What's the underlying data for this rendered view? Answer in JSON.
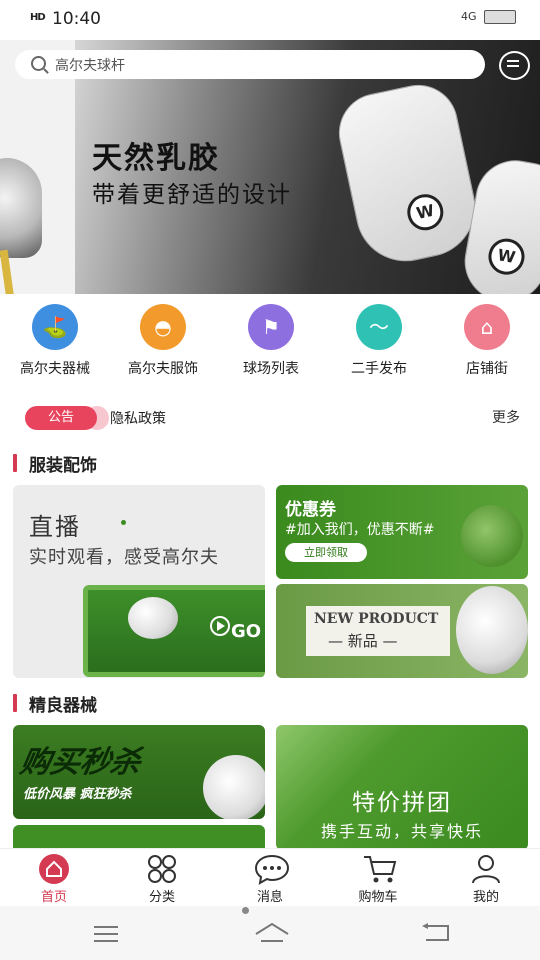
{
  "status_bar": {
    "time": "10:40",
    "signal": "HD",
    "network": "4G"
  },
  "search": {
    "placeholder": "高尔夫球杆"
  },
  "banner": {
    "title": "天然乳胶",
    "subtitle": "带着更舒适的设计",
    "glove_mark": "W"
  },
  "categories": [
    {
      "label": "高尔夫器械",
      "color": "#3f8fe0",
      "icon": "golf-club-icon"
    },
    {
      "label": "高尔夫服饰",
      "color": "#f39a2c",
      "icon": "cap-icon"
    },
    {
      "label": "球场列表",
      "color": "#8e6fe0",
      "icon": "golf-course-icon"
    },
    {
      "label": "二手发布",
      "color": "#2fc2b4",
      "icon": "exchange-icon"
    },
    {
      "label": "店铺街",
      "color": "#f07d8e",
      "icon": "shop-icon"
    }
  ],
  "notice": {
    "tag": "公告",
    "text": "隐私政策",
    "more": "更多"
  },
  "sections": {
    "apparel": "服装配饰",
    "equipment": "精良器械"
  },
  "live_card": {
    "title": "直播",
    "subtitle": "实时观看，感受高尔夫",
    "go": "GO"
  },
  "coupon_card": {
    "title": "优惠券",
    "subtitle": "#加入我们，优惠不断#",
    "button": "立即领取"
  },
  "new_product_card": {
    "title": "NEW PRODUCT",
    "subtitle": "— 新品 —"
  },
  "flash_sale_card": {
    "title": "购买秒杀",
    "subtitle": "低价风暴  疯狂秒杀"
  },
  "group_buy_card": {
    "title": "特价拼团",
    "subtitle": "携手互动，共享快乐"
  },
  "tabbar": [
    {
      "label": "首页",
      "icon": "home-icon",
      "active": true
    },
    {
      "label": "分类",
      "icon": "grid-icon",
      "active": false
    },
    {
      "label": "消息",
      "icon": "chat-icon",
      "active": false
    },
    {
      "label": "购物车",
      "icon": "cart-icon",
      "active": false
    },
    {
      "label": "我的",
      "icon": "user-icon",
      "active": false
    }
  ],
  "colors": {
    "accent": "#d43a52",
    "notice_tag": "#e8445d",
    "green": "#3a8a1e"
  }
}
